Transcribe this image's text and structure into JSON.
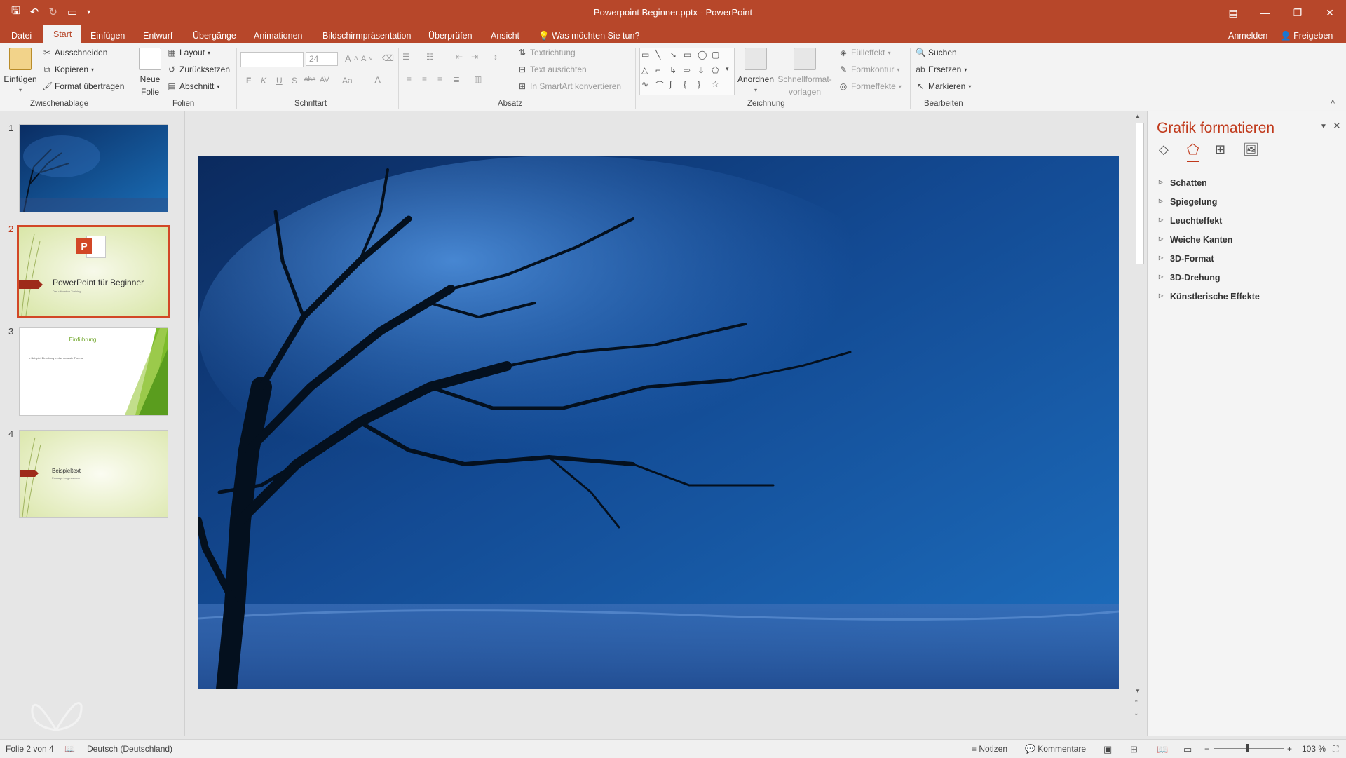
{
  "window": {
    "title": "Powerpoint Beginner.pptx - PowerPoint"
  },
  "tabs": [
    "Datei",
    "Start",
    "Einfügen",
    "Entwurf",
    "Übergänge",
    "Animationen",
    "Bildschirmpräsentation",
    "Überprüfen",
    "Ansicht"
  ],
  "tell_me": "Was möchten Sie tun?",
  "account": {
    "signin": "Anmelden",
    "share": "Freigeben"
  },
  "ribbon": {
    "clipboard": {
      "paste": "Einfügen",
      "cut": "Ausschneiden",
      "copy": "Kopieren",
      "format_painter": "Format übertragen",
      "label": "Zwischenablage"
    },
    "slides": {
      "new_slide": "Neue",
      "new_slide2": "Folie",
      "layout": "Layout",
      "reset": "Zurücksetzen",
      "section": "Abschnitt",
      "label": "Folien"
    },
    "font": {
      "size": "24",
      "bold": "F",
      "italic": "K",
      "underline": "U",
      "shadow": "S",
      "strike": "abc",
      "spacing": "AV",
      "case": "Aa",
      "color": "A",
      "grow": "A",
      "shrink": "A",
      "label": "Schriftart"
    },
    "paragraph": {
      "text_direction": "Textrichtung",
      "align_text": "Text ausrichten",
      "smartart": "In SmartArt konvertieren",
      "label": "Absatz"
    },
    "drawing": {
      "arrange": "Anordnen",
      "quick_styles": "Schnellformat-",
      "quick_styles2": "vorlagen",
      "fill": "Fülleffekt",
      "outline": "Formkontur",
      "effects": "Formeffekte",
      "label": "Zeichnung"
    },
    "editing": {
      "find": "Suchen",
      "replace": "Ersetzen",
      "select": "Markieren",
      "label": "Bearbeiten"
    }
  },
  "thumbnails": [
    {
      "num": "1"
    },
    {
      "num": "2",
      "title": "PowerPoint für Beginner",
      "subtitle": "Das ultimative Training"
    },
    {
      "num": "3",
      "title": "Einführung",
      "bullet": "Beispiel Einleitung in das neueste Thema"
    },
    {
      "num": "4",
      "title": "Beispieltext",
      "subtitle": "Passage im gesamten"
    }
  ],
  "format_pane": {
    "title": "Grafik formatieren",
    "items": [
      "Schatten",
      "Spiegelung",
      "Leuchteffekt",
      "Weiche Kanten",
      "3D-Format",
      "3D-Drehung",
      "Künstlerische Effekte"
    ]
  },
  "status": {
    "slide_info": "Folie 2 von 4",
    "language": "Deutsch (Deutschland)",
    "notes": "Notizen",
    "comments": "Kommentare",
    "zoom": "103 %"
  },
  "colors": {
    "accent": "#b7472a",
    "selection": "#d24726",
    "pane_title": "#c0391b"
  }
}
